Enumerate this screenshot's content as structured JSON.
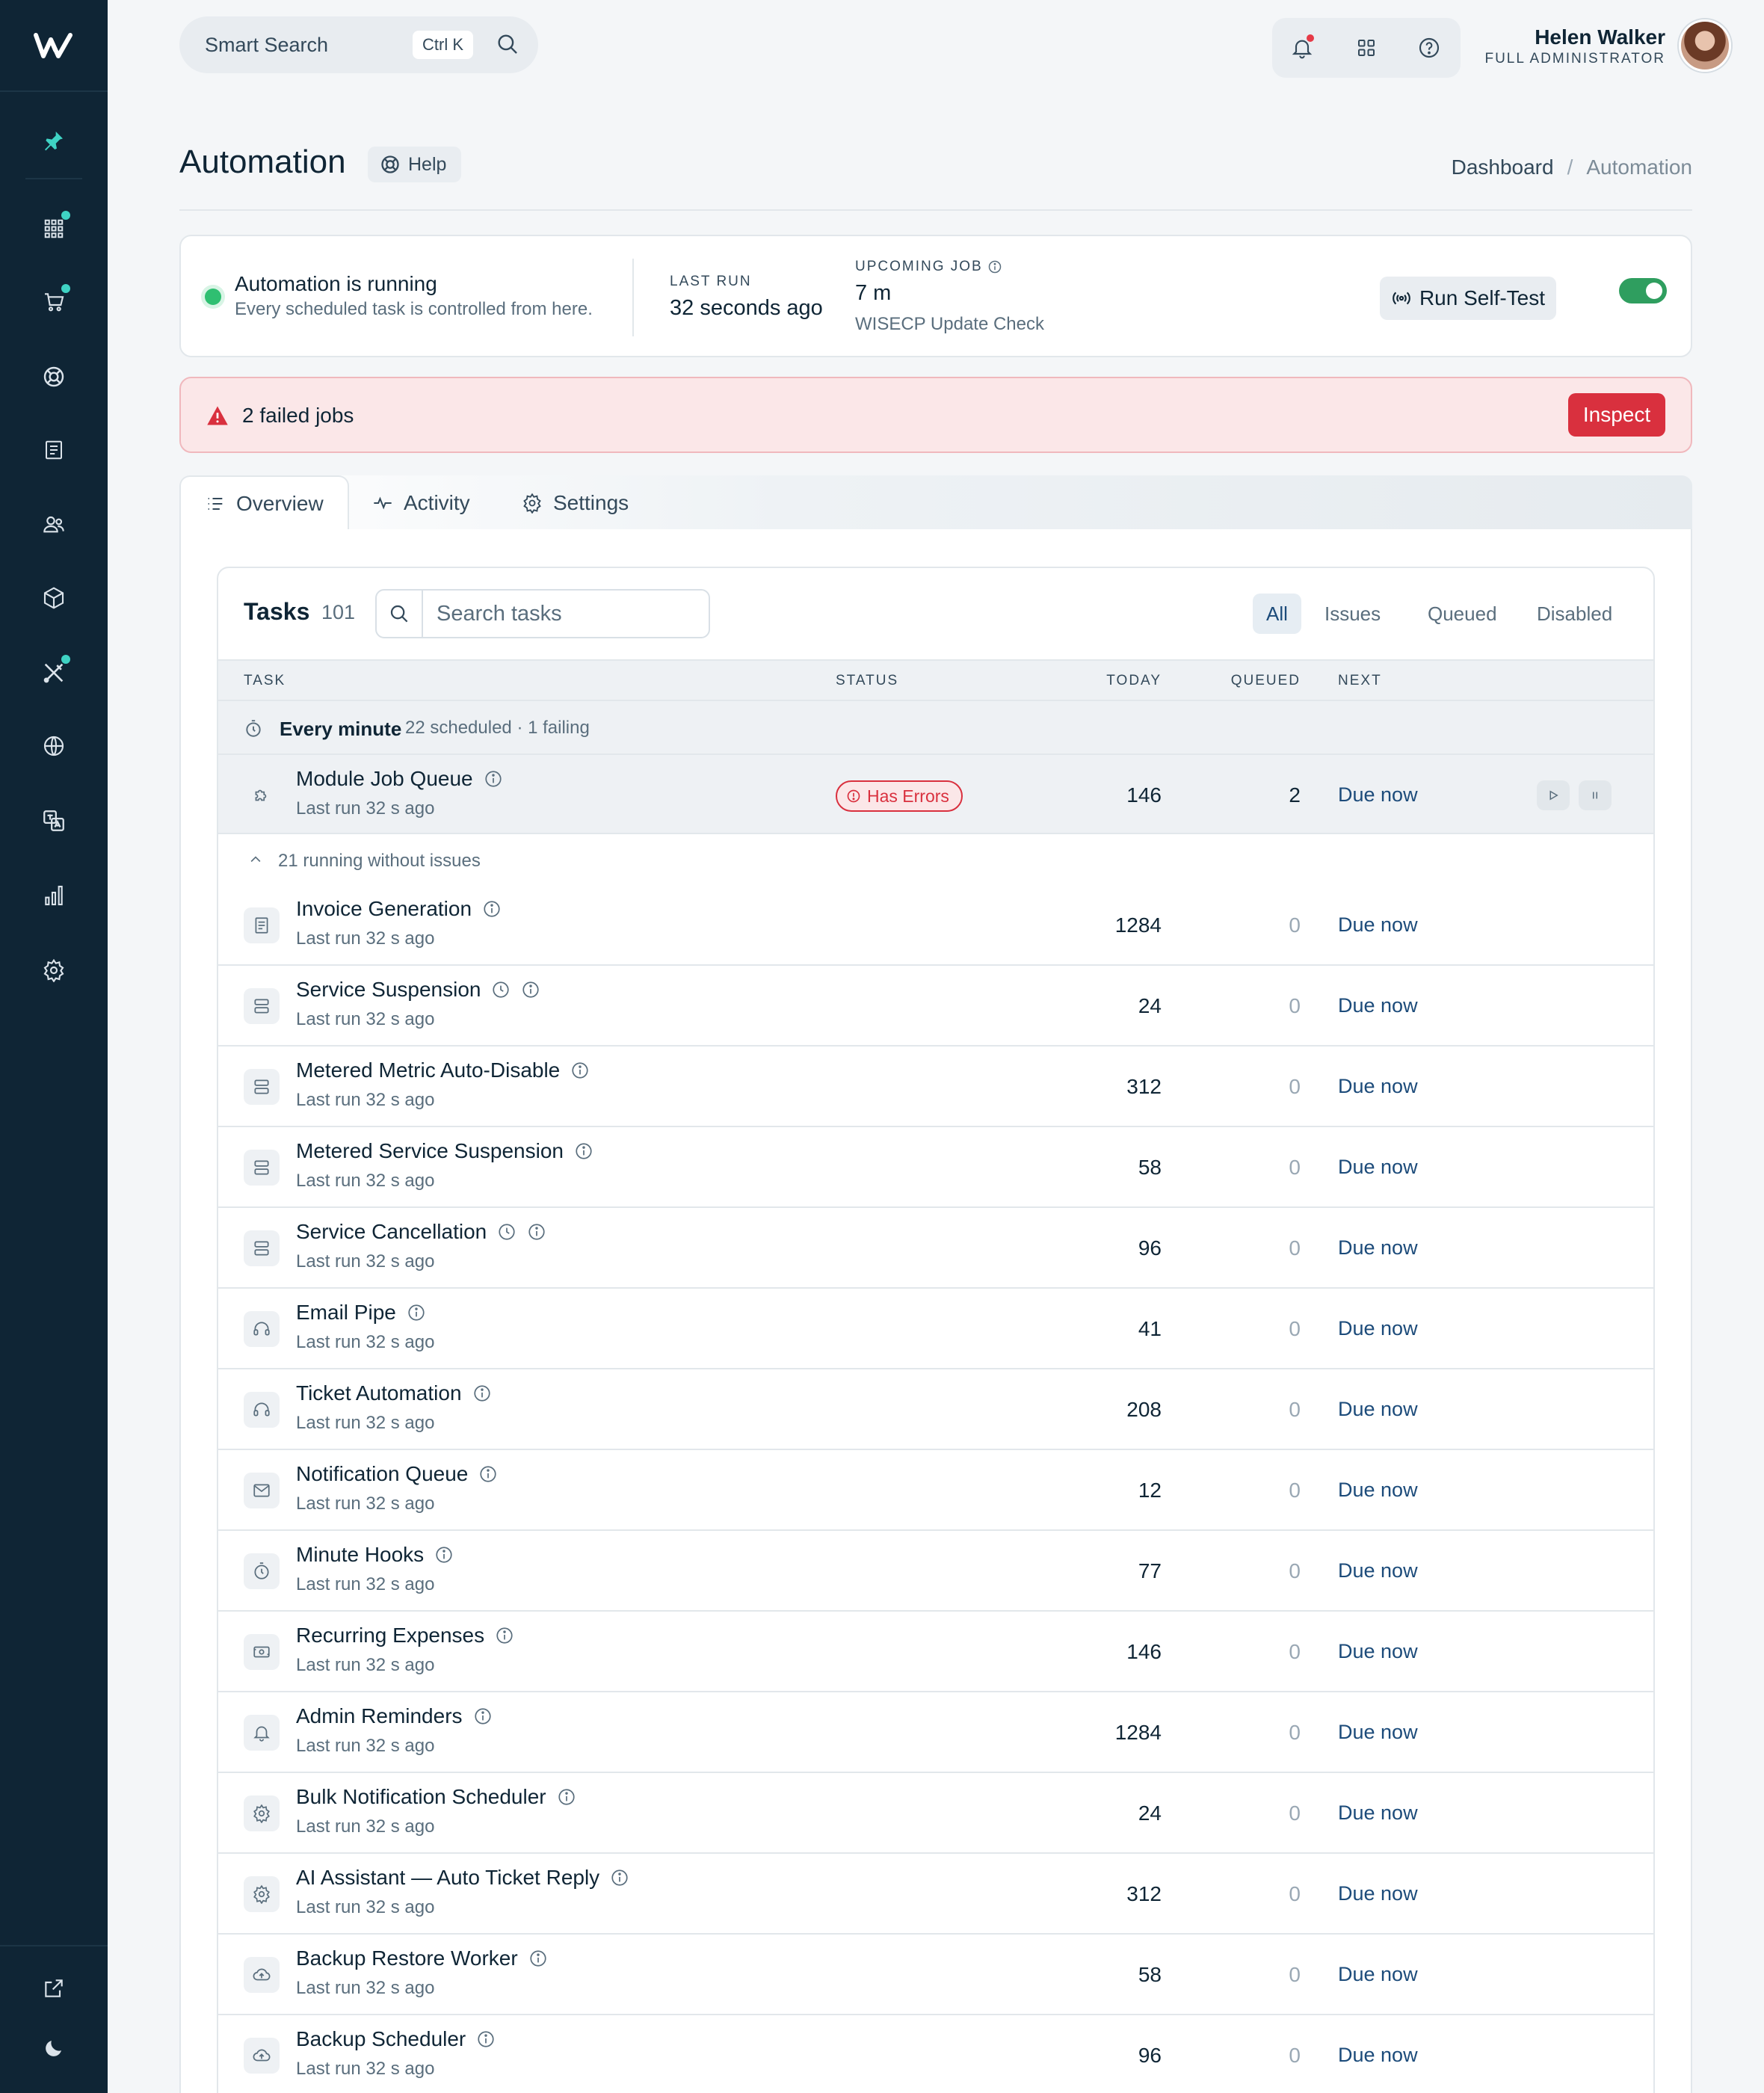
{
  "topbar": {
    "search_label": "Smart Search",
    "search_shortcut": "Ctrl K",
    "user_name": "Helen Walker",
    "user_role": "FULL ADMINISTRATOR"
  },
  "page": {
    "title": "Automation",
    "help_label": "Help",
    "breadcrumb": [
      "Dashboard",
      "/",
      "Automation"
    ]
  },
  "status": {
    "title": "Automation is running",
    "subtitle": "Every scheduled task is controlled from here.",
    "last_run_label": "LAST RUN",
    "last_run_value": "32 seconds ago",
    "upcoming_label": "UPCOMING JOB",
    "upcoming_value": "7 m",
    "upcoming_name": "WISECP Update Check",
    "selftest_label": "Run Self-Test",
    "enabled": true
  },
  "alert": {
    "text": "2 failed jobs",
    "button": "Inspect"
  },
  "tabs": [
    {
      "label": "Overview",
      "active": true,
      "icon": "list-icon"
    },
    {
      "label": "Activity",
      "active": false,
      "icon": "pulse-icon"
    },
    {
      "label": "Settings",
      "active": false,
      "icon": "gear-icon"
    }
  ],
  "tasks": {
    "title": "Tasks",
    "count": "101",
    "search_placeholder": "Search tasks",
    "filters": [
      "All",
      "Issues",
      "Queued",
      "Disabled"
    ],
    "columns": [
      "TASK",
      "STATUS",
      "TODAY",
      "QUEUED",
      "NEXT"
    ],
    "group": {
      "title": "Every minute",
      "summary": "22 scheduled · 1 failing"
    },
    "error_row": {
      "name": "Module Job Queue",
      "sub": "Last run 32 s ago",
      "status": "Has Errors",
      "today": "146",
      "queued": "2",
      "next": "Due now",
      "icon": "puzzle-icon"
    },
    "collapsed_label": "21 running without issues",
    "rows": [
      {
        "name": "Invoice Generation",
        "sub": "Last run 32 s ago",
        "today": "1284",
        "queued": "0",
        "next": "Due now",
        "icon": "receipt-icon",
        "clock": false
      },
      {
        "name": "Service Suspension",
        "sub": "Last run 32 s ago",
        "today": "24",
        "queued": "0",
        "next": "Due now",
        "icon": "server-icon",
        "clock": true
      },
      {
        "name": "Metered Metric Auto-Disable",
        "sub": "Last run 32 s ago",
        "today": "312",
        "queued": "0",
        "next": "Due now",
        "icon": "server-icon",
        "clock": false
      },
      {
        "name": "Metered Service Suspension",
        "sub": "Last run 32 s ago",
        "today": "58",
        "queued": "0",
        "next": "Due now",
        "icon": "server-icon",
        "clock": false
      },
      {
        "name": "Service Cancellation",
        "sub": "Last run 32 s ago",
        "today": "96",
        "queued": "0",
        "next": "Due now",
        "icon": "server-icon",
        "clock": true
      },
      {
        "name": "Email Pipe",
        "sub": "Last run 32 s ago",
        "today": "41",
        "queued": "0",
        "next": "Due now",
        "icon": "headset-icon",
        "clock": false
      },
      {
        "name": "Ticket Automation",
        "sub": "Last run 32 s ago",
        "today": "208",
        "queued": "0",
        "next": "Due now",
        "icon": "headset-icon",
        "clock": false
      },
      {
        "name": "Notification Queue",
        "sub": "Last run 32 s ago",
        "today": "12",
        "queued": "0",
        "next": "Due now",
        "icon": "mail-icon",
        "clock": false
      },
      {
        "name": "Minute Hooks",
        "sub": "Last run 32 s ago",
        "today": "77",
        "queued": "0",
        "next": "Due now",
        "icon": "stopwatch-icon",
        "clock": false
      },
      {
        "name": "Recurring Expenses",
        "sub": "Last run 32 s ago",
        "today": "146",
        "queued": "0",
        "next": "Due now",
        "icon": "cash-icon",
        "clock": false
      },
      {
        "name": "Admin Reminders",
        "sub": "Last run 32 s ago",
        "today": "1284",
        "queued": "0",
        "next": "Due now",
        "icon": "bell-icon",
        "clock": false
      },
      {
        "name": "Bulk Notification Scheduler",
        "sub": "Last run 32 s ago",
        "today": "24",
        "queued": "0",
        "next": "Due now",
        "icon": "gear-icon",
        "clock": false
      },
      {
        "name": "AI Assistant — Auto Ticket Reply",
        "sub": "Last run 32 s ago",
        "today": "312",
        "queued": "0",
        "next": "Due now",
        "icon": "gear-icon",
        "clock": false
      },
      {
        "name": "Backup Restore Worker",
        "sub": "Last run 32 s ago",
        "today": "58",
        "queued": "0",
        "next": "Due now",
        "icon": "cloud-upload-icon",
        "clock": false
      },
      {
        "name": "Backup Scheduler",
        "sub": "Last run 32 s ago",
        "today": "96",
        "queued": "0",
        "next": "Due now",
        "icon": "cloud-upload-icon",
        "clock": false
      }
    ]
  },
  "sidebar": {
    "items": [
      "pin-icon",
      "grid-icon",
      "cart-icon",
      "lifebuoy-icon",
      "receipt-icon",
      "users-icon",
      "box-icon",
      "tools-icon",
      "globe-icon",
      "translate-icon",
      "bar-chart-icon",
      "gear-icon"
    ],
    "bottom": [
      "external-link-icon",
      "moon-icon"
    ]
  },
  "colors": {
    "sidebar_bg": "#0f2535",
    "accent_teal": "#3fd3c4",
    "danger": "#d9303e",
    "success": "#2fbf71",
    "link": "#1c4b7a"
  }
}
